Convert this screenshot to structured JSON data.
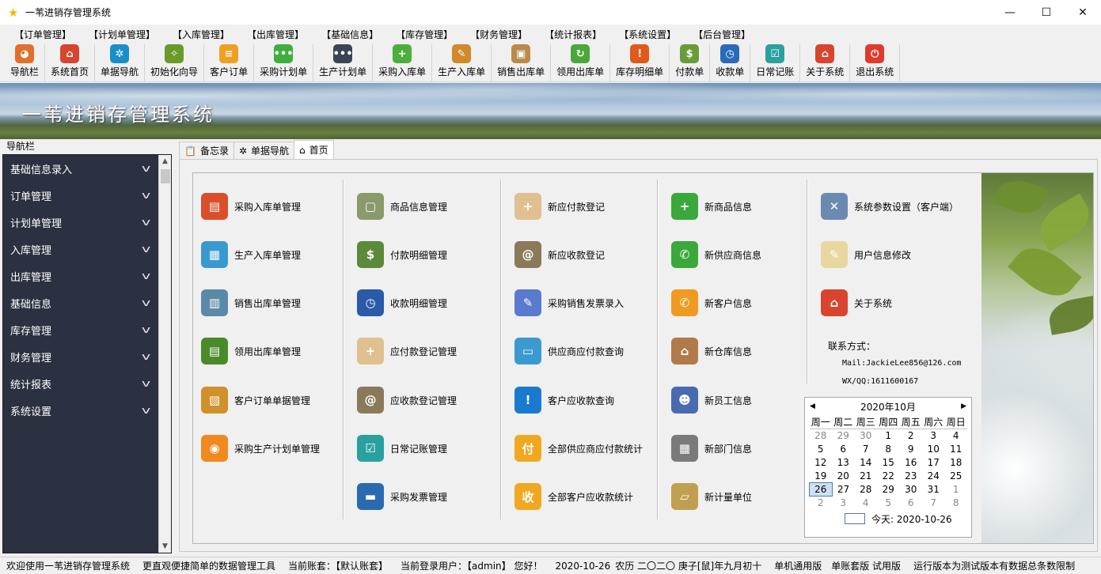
{
  "window": {
    "title": "一苇进销存管理系统",
    "minimize": "—",
    "maximize": "☐",
    "close": "✕"
  },
  "menu": [
    "【订单管理】",
    "【计划单管理】",
    "【入库管理】",
    "【出库管理】",
    "【基础信息】",
    "【库存管理】",
    "【财务管理】",
    "【统计报表】",
    "【系统设置】",
    "【后台管理】"
  ],
  "toolbar": [
    {
      "label": "导航栏",
      "icon": "pie-chart-icon",
      "color": "#e0702a",
      "glyph": "◕"
    },
    {
      "label": "系统首页",
      "icon": "home-icon",
      "color": "#d9442e",
      "glyph": "⌂"
    },
    {
      "label": "单据导航",
      "icon": "compass-icon",
      "color": "#1a8fc7",
      "glyph": "✲"
    },
    {
      "label": "初始化向导",
      "icon": "wand-icon",
      "color": "#6a9a2a",
      "glyph": "✧"
    },
    {
      "label": "客户订单",
      "icon": "order-icon",
      "color": "#f0a020",
      "glyph": "≡"
    },
    {
      "label": "采购计划单",
      "icon": "chat-green-icon",
      "color": "#3fae3f",
      "glyph": "•••"
    },
    {
      "label": "生产计划单",
      "icon": "chat-dark-icon",
      "color": "#3a4454",
      "glyph": "•••"
    },
    {
      "label": "采购入库单",
      "icon": "add-green-icon",
      "color": "#4caf3c",
      "glyph": "+"
    },
    {
      "label": "生产入库单",
      "icon": "notebook-icon",
      "color": "#d08a2a",
      "glyph": "✎"
    },
    {
      "label": "销售出库单",
      "icon": "box-icon",
      "color": "#b98a4a",
      "glyph": "▣"
    },
    {
      "label": "领用出库单",
      "icon": "refresh-arrow-icon",
      "color": "#4aa83a",
      "glyph": "↻"
    },
    {
      "label": "库存明细单",
      "icon": "warning-icon",
      "color": "#e05a1a",
      "glyph": "!"
    },
    {
      "label": "付款单",
      "icon": "money-icon",
      "color": "#6a9a3a",
      "glyph": "$"
    },
    {
      "label": "收款单",
      "icon": "clock-icon",
      "color": "#2a6ab8",
      "glyph": "◷"
    },
    {
      "label": "日常记账",
      "icon": "checklist-icon",
      "color": "#2aa0a0",
      "glyph": "☑"
    },
    {
      "label": "关于系统",
      "icon": "house-icon",
      "color": "#d9442e",
      "glyph": "⌂"
    },
    {
      "label": "退出系统",
      "icon": "power-icon",
      "color": "#e03a2a",
      "glyph": "⏻"
    }
  ],
  "banner": {
    "title": "一苇进销存管理系统"
  },
  "nav": {
    "caption": "导航栏",
    "items": [
      "基础信息录入",
      "订单管理",
      "计划单管理",
      "入库管理",
      "出库管理",
      "基础信息",
      "库存管理",
      "财务管理",
      "统计报表",
      "系统设置"
    ]
  },
  "tabs": [
    {
      "label": "备忘录",
      "icon": "memo-icon",
      "glyph": "📋"
    },
    {
      "label": "单据导航",
      "icon": "compass-icon",
      "glyph": "✲"
    },
    {
      "label": "首页",
      "icon": "home-icon",
      "glyph": "⌂"
    }
  ],
  "columns": [
    [
      {
        "label": "采购入库单管理",
        "icon": "books-icon",
        "color": "#d94f2a",
        "glyph": "▤"
      },
      {
        "label": "生产入库单管理",
        "icon": "stack-icon",
        "color": "#3a9ad0",
        "glyph": "▦"
      },
      {
        "label": "销售出库单管理",
        "icon": "layers-icon",
        "color": "#5a8aa8",
        "glyph": "▥"
      },
      {
        "label": "领用出库单管理",
        "icon": "green-books-icon",
        "color": "#4a8a2a",
        "glyph": "▤"
      },
      {
        "label": "客户订单单据管理",
        "icon": "documents-icon",
        "color": "#d0902a",
        "glyph": "▧"
      },
      {
        "label": "采购生产计划单管理",
        "icon": "rss-icon",
        "color": "#f08a20",
        "glyph": "◉"
      }
    ],
    [
      {
        "label": "商品信息管理",
        "icon": "product-icon",
        "color": "#8a9a6a",
        "glyph": "▢"
      },
      {
        "label": "付款明细管理",
        "icon": "payment-icon",
        "color": "#5a8a3a",
        "glyph": "$"
      },
      {
        "label": "收款明细管理",
        "icon": "receipt-clock-icon",
        "color": "#2a5aa8",
        "glyph": "◷"
      },
      {
        "label": "应付款登记管理",
        "icon": "hand-add-icon",
        "color": "#e0c090",
        "glyph": "+"
      },
      {
        "label": "应收款登记管理",
        "icon": "addressbook-icon",
        "color": "#8a7a5a",
        "glyph": "@"
      },
      {
        "label": "日常记账管理",
        "icon": "checklist-icon",
        "color": "#2aa0a0",
        "glyph": "☑"
      },
      {
        "label": "采购发票管理",
        "icon": "blue-book-icon",
        "color": "#2a6ab0",
        "glyph": "▬"
      }
    ],
    [
      {
        "label": "新应付款登记",
        "icon": "hand-add-icon",
        "color": "#e0c090",
        "glyph": "+"
      },
      {
        "label": "新应收款登记",
        "icon": "addressbook-icon",
        "color": "#8a7a5a",
        "glyph": "@"
      },
      {
        "label": "采购销售发票录入",
        "icon": "notepad-icon",
        "color": "#5a7ad0",
        "glyph": "✎"
      },
      {
        "label": "供应商应付款查询",
        "icon": "chat-bubbles-icon",
        "color": "#3a9ad0",
        "glyph": "▭"
      },
      {
        "label": "客户应收款查询",
        "icon": "info-bubble-icon",
        "color": "#1a7ad0",
        "glyph": "!"
      },
      {
        "label": "全部供应商应付款统计",
        "icon": "pay-coin-icon",
        "color": "#f0a820",
        "glyph": "付"
      },
      {
        "label": "全部客户应收款统计",
        "icon": "receive-coin-icon",
        "color": "#f0a820",
        "glyph": "收"
      }
    ],
    [
      {
        "label": "新商品信息",
        "icon": "plus-icon",
        "color": "#3aa83a",
        "glyph": "+"
      },
      {
        "label": "新供应商信息",
        "icon": "phone-green-icon",
        "color": "#3aa83a",
        "glyph": "✆"
      },
      {
        "label": "新客户信息",
        "icon": "phone-orange-icon",
        "color": "#f09a20",
        "glyph": "✆"
      },
      {
        "label": "新仓库信息",
        "icon": "warehouse-icon",
        "color": "#b07a4a",
        "glyph": "⌂"
      },
      {
        "label": "新员工信息",
        "icon": "people-icon",
        "color": "#4a6ab0",
        "glyph": "☻"
      },
      {
        "label": "新部门信息",
        "icon": "org-chart-icon",
        "color": "#7a7a7a",
        "glyph": "▦"
      },
      {
        "label": "新计量单位",
        "icon": "ruler-icon",
        "color": "#c0a050",
        "glyph": "▱"
      }
    ],
    [
      {
        "label": "系统参数设置（客户端）",
        "icon": "tools-icon",
        "color": "#6a8ab0",
        "glyph": "✕"
      },
      {
        "label": "用户信息修改",
        "icon": "note-pin-icon",
        "color": "#e8d8a0",
        "glyph": "✎"
      },
      {
        "label": "关于系统",
        "icon": "house-icon",
        "color": "#d9442e",
        "glyph": "⌂"
      }
    ]
  ],
  "contact": {
    "title": "联系方式：",
    "mail": "Mail:JackieLee856@126.com",
    "qq": "WX/QQ:1611600167"
  },
  "calendar": {
    "month": "2020年10月",
    "prev": "◀",
    "next": "▶",
    "weekdays": [
      "周一",
      "周二",
      "周三",
      "周四",
      "周五",
      "周六",
      "周日"
    ],
    "weeks": [
      [
        {
          "d": "28",
          "o": true
        },
        {
          "d": "29",
          "o": true
        },
        {
          "d": "30",
          "o": true
        },
        {
          "d": "1"
        },
        {
          "d": "2"
        },
        {
          "d": "3"
        },
        {
          "d": "4"
        }
      ],
      [
        {
          "d": "5"
        },
        {
          "d": "6"
        },
        {
          "d": "7"
        },
        {
          "d": "8"
        },
        {
          "d": "9"
        },
        {
          "d": "10"
        },
        {
          "d": "11"
        }
      ],
      [
        {
          "d": "12"
        },
        {
          "d": "13"
        },
        {
          "d": "14"
        },
        {
          "d": "15"
        },
        {
          "d": "16"
        },
        {
          "d": "17"
        },
        {
          "d": "18"
        }
      ],
      [
        {
          "d": "19"
        },
        {
          "d": "20"
        },
        {
          "d": "21"
        },
        {
          "d": "22"
        },
        {
          "d": "23"
        },
        {
          "d": "24"
        },
        {
          "d": "25"
        }
      ],
      [
        {
          "d": "26",
          "t": true
        },
        {
          "d": "27"
        },
        {
          "d": "28"
        },
        {
          "d": "29"
        },
        {
          "d": "30"
        },
        {
          "d": "31"
        },
        {
          "d": "1",
          "o": true
        }
      ],
      [
        {
          "d": "2",
          "o": true
        },
        {
          "d": "3",
          "o": true
        },
        {
          "d": "4",
          "o": true
        },
        {
          "d": "5",
          "o": true
        },
        {
          "d": "6",
          "o": true
        },
        {
          "d": "7",
          "o": true
        },
        {
          "d": "8",
          "o": true
        }
      ]
    ],
    "today_label": "今天: 2020-10-26"
  },
  "status": {
    "welcome": "欢迎使用一苇进销存管理系统",
    "slogan": "更直观便捷简单的数据管理工具",
    "account": "当前账套：【默认账套】",
    "user": "当前登录用户：【admin】 您好！",
    "date": "2020-10-26",
    "lunar": "农历 二〇二〇 庚子[鼠]年九月初十",
    "edition": "单机通用版",
    "trial": "单账套版 试用版",
    "notice": "运行版本为测试版本有数据总条数限制"
  }
}
